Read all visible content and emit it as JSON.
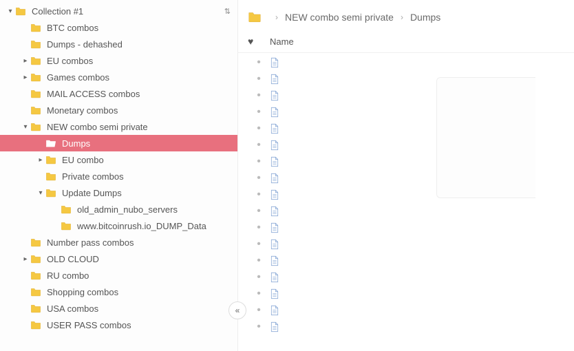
{
  "sidebar": {
    "root": {
      "label": "Collection #1",
      "children": [
        {
          "label": "BTC combos",
          "depth": 1
        },
        {
          "label": "Dumps - dehashed",
          "depth": 1
        },
        {
          "label": "EU combos",
          "depth": 1,
          "expandable": true,
          "expanded": false
        },
        {
          "label": "Games combos",
          "depth": 1,
          "expandable": true,
          "expanded": false
        },
        {
          "label": "MAIL ACCESS combos",
          "depth": 1
        },
        {
          "label": "Monetary combos",
          "depth": 1
        },
        {
          "label": "NEW combo semi private",
          "depth": 1,
          "expandable": true,
          "expanded": true
        },
        {
          "label": "Dumps",
          "depth": 2,
          "selected": true,
          "open": true
        },
        {
          "label": "EU combo",
          "depth": 2,
          "expandable": true,
          "expanded": false
        },
        {
          "label": "Private combos",
          "depth": 2
        },
        {
          "label": "Update Dumps",
          "depth": 2,
          "expandable": true,
          "expanded": true
        },
        {
          "label": "old_admin_nubo_servers",
          "depth": 3
        },
        {
          "label": "www.bitcoinrush.io_DUMP_Data",
          "depth": 3
        },
        {
          "label": "Number pass combos",
          "depth": 1
        },
        {
          "label": "OLD CLOUD",
          "depth": 1,
          "expandable": true,
          "expanded": false
        },
        {
          "label": "RU combo",
          "depth": 1
        },
        {
          "label": "Shopping combos",
          "depth": 1
        },
        {
          "label": "USA combos",
          "depth": 1
        },
        {
          "label": "USER PASS combos",
          "depth": 1
        }
      ]
    }
  },
  "breadcrumb": {
    "items": [
      "NEW combo semi private",
      "Dumps"
    ]
  },
  "columns": {
    "favorite": "♥",
    "name": "Name"
  },
  "files": {
    "count": 17
  },
  "collapse_label": "«"
}
